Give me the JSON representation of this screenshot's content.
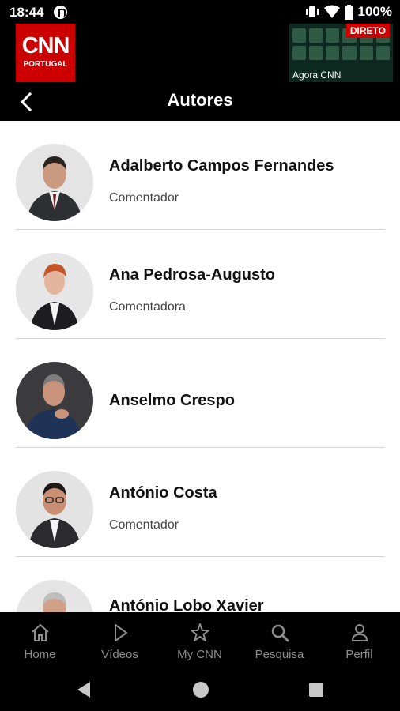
{
  "status_bar": {
    "time": "18:44",
    "battery": "100%",
    "icons": [
      "app-notification-icon",
      "vibrate-icon",
      "wifi-icon",
      "battery-icon"
    ]
  },
  "header": {
    "logo_text": "CNN",
    "logo_subtext": "PORTUGAL",
    "live_badge": "DIRETO",
    "live_caption": "Agora CNN",
    "title": "Autores",
    "brand_color": "#cc0000"
  },
  "authors": [
    {
      "name": "Adalberto Campos Fernandes",
      "role": "Comentador"
    },
    {
      "name": "Ana Pedrosa-Augusto",
      "role": "Comentadora"
    },
    {
      "name": "Anselmo Crespo",
      "role": ""
    },
    {
      "name": "António Costa",
      "role": "Comentador"
    },
    {
      "name": "António Lobo Xavier",
      "role": ""
    }
  ],
  "bottom_nav": {
    "items": [
      {
        "label": "Home",
        "icon": "home-icon"
      },
      {
        "label": "Vídeos",
        "icon": "play-icon"
      },
      {
        "label": "My CNN",
        "icon": "star-icon"
      },
      {
        "label": "Pesquisa",
        "icon": "search-icon"
      },
      {
        "label": "Perfil",
        "icon": "person-icon"
      }
    ]
  }
}
